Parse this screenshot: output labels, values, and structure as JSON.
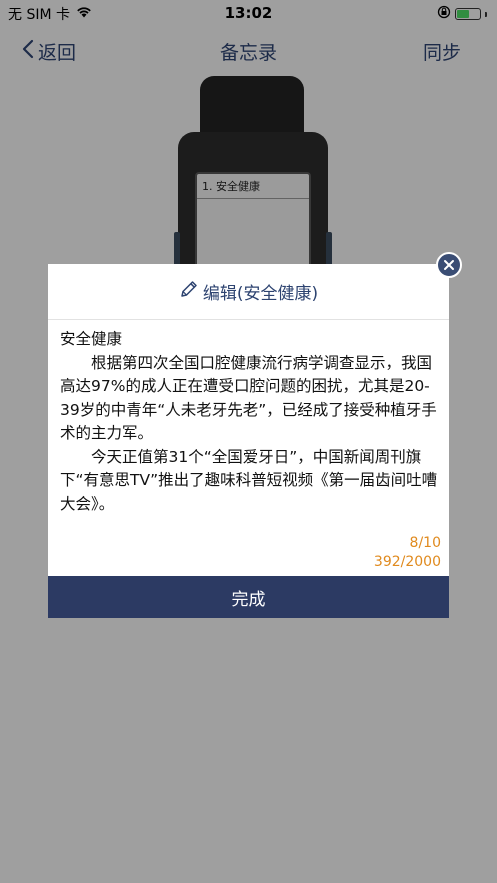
{
  "status_bar": {
    "carrier": "无 SIM 卡",
    "time": "13:02",
    "battery_level": 0.6,
    "battery_color": "#4cd964"
  },
  "nav": {
    "back_label": "返回",
    "title": "备忘录",
    "sync_label": "同步"
  },
  "watch": {
    "screen_item": "1. 安全健康"
  },
  "dialog": {
    "title": "编辑(安全健康)",
    "title_icon": "pencil-icon",
    "content_title": "安全健康",
    "paragraph1": "根据第四次全国口腔健康流行病学调查显示，我国高达97%的成人正在遭受口腔问题的困扰，尤其是20-39岁的中青年“人未老牙先老”，已经成了接受种植牙手术的主力军。",
    "paragraph2": "今天正值第31个“全国爱牙日”，中国新闻周刊旗下“有意思TV”推出了趣味科普短视频《第一届齿间吐嘈大会》。",
    "item_count": "8/10",
    "char_count": "392/2000",
    "done_label": "完成",
    "close_icon": "close-icon"
  },
  "colors": {
    "accent": "#2d4370",
    "button": "#2c3a63",
    "count": "#e08a1e"
  }
}
